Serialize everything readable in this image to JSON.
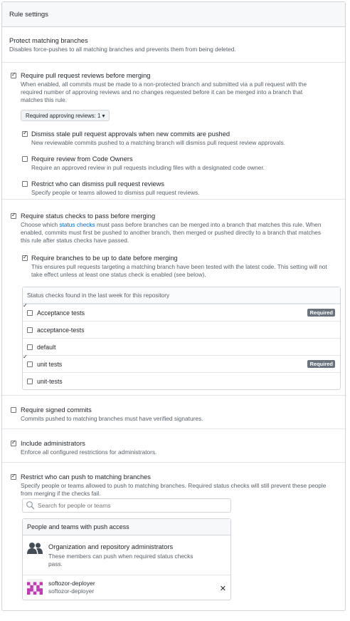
{
  "panel": {
    "title": "Rule settings"
  },
  "protect": {
    "title": "Protect matching branches",
    "desc": "Disables force-pushes to all matching branches and prevents them from being deleted."
  },
  "pr_reviews": {
    "title": "Require pull request reviews before merging",
    "checked": true,
    "desc_lines": [
      "When enabled, all commits must be made to a non-protected branch and submitted via a pull request with the",
      "required number of approving reviews and no changes requested before it can be merged into a branch that",
      "matches this rule."
    ],
    "select_label": "Required approving reviews: 1 ▾",
    "dismiss_stale": {
      "title": "Dismiss stale pull request approvals when new commits are pushed",
      "desc": "New reviewable commits pushed to a matching branch will dismiss pull request review approvals.",
      "checked": true
    },
    "code_owners": {
      "title": "Require review from Code Owners",
      "desc": "Require an approved review in pull requests including files with a designated code owner.",
      "checked": false
    },
    "restrict_dismiss": {
      "title": "Restrict who can dismiss pull request reviews",
      "desc": "Specify people or teams allowed to dismiss pull request reviews.",
      "checked": false
    }
  },
  "status_checks": {
    "title": "Require status checks to pass before merging",
    "checked": true,
    "desc_pre": "Choose which ",
    "desc_link": "status checks",
    "desc_post": " must pass before branches can be merged into a branch that matches this rule. When",
    "desc_line2": "enabled, commits must first be pushed to another branch, then merged or pushed directly to a branch that matches",
    "desc_line3": "this rule after status checks have passed.",
    "up_to_date": {
      "title": "Require branches to be up to date before merging",
      "checked": true,
      "desc_line1": "This ensures pull requests targeting a matching branch have been tested with the latest code. This setting will not",
      "desc_line2": "take effect unless at least one status check is enabled (see below)."
    },
    "box_header": "Status checks found in the last week for this repository",
    "checks": [
      {
        "name": "Acceptance tests",
        "checked": true,
        "badge": "Required"
      },
      {
        "name": "acceptance-tests",
        "checked": false,
        "badge": ""
      },
      {
        "name": "default",
        "checked": false,
        "badge": ""
      },
      {
        "name": "unit tests",
        "checked": true,
        "badge": "Required"
      },
      {
        "name": "unit-tests",
        "checked": false,
        "badge": ""
      }
    ]
  },
  "signed": {
    "title": "Require signed commits",
    "desc": "Commits pushed to matching branches must have verified signatures.",
    "checked": false
  },
  "admins": {
    "title": "Include administrators",
    "desc": "Enforce all configured restrictions for administrators.",
    "checked": true
  },
  "restrict_push": {
    "title": "Restrict who can push to matching branches",
    "checked": true,
    "desc_line1": "Specify people or teams allowed to push to matching branches. Required status checks will still prevent these people",
    "desc_line2": "from merging if the checks fail.",
    "search_placeholder": "Search for people or teams",
    "box_header": "People and teams with push access",
    "org_title": "Organization and repository administrators",
    "org_desc_line1": "These members can push when required status checks",
    "org_desc_line2": "pass.",
    "user_name": "softozor-deployer",
    "user_login": "softozor-deployer",
    "remove_glyph": "✕"
  },
  "colors": {
    "link": "#0366d6",
    "badge": "#6a737d",
    "avatar": "#c238b5"
  }
}
